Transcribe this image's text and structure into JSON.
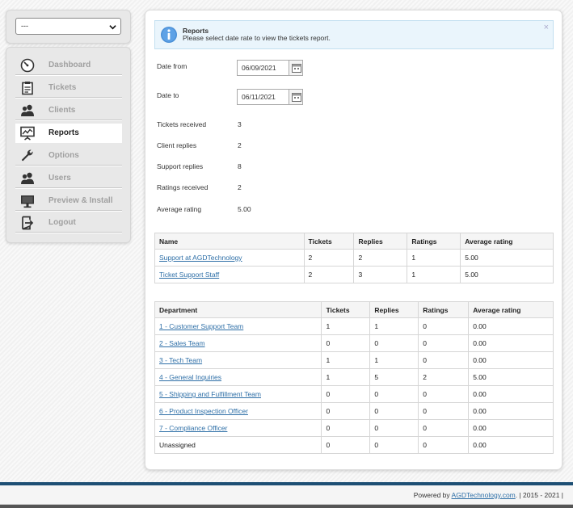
{
  "sidebar": {
    "select_value": "---",
    "items": [
      {
        "label": "Dashboard",
        "icon": "gauge-icon",
        "active": false
      },
      {
        "label": "Tickets",
        "icon": "clipboard-icon",
        "active": false
      },
      {
        "label": "Clients",
        "icon": "users-icon",
        "active": false
      },
      {
        "label": "Reports",
        "icon": "presentation-icon",
        "active": true
      },
      {
        "label": "Options",
        "icon": "wrench-icon",
        "active": false
      },
      {
        "label": "Users",
        "icon": "users-icon",
        "active": false
      },
      {
        "label": "Preview & Install",
        "icon": "monitor-icon",
        "active": false
      },
      {
        "label": "Logout",
        "icon": "logout-icon",
        "active": false
      }
    ]
  },
  "alert": {
    "title": "Reports",
    "message": "Please select date rate to view the tickets report.",
    "close": "×"
  },
  "form": {
    "date_from_label": "Date from",
    "date_from_value": "06/09/2021",
    "date_to_label": "Date to",
    "date_to_value": "06/11/2021"
  },
  "stats": [
    {
      "label": "Tickets received",
      "value": "3"
    },
    {
      "label": "Client replies",
      "value": "2"
    },
    {
      "label": "Support replies",
      "value": "8"
    },
    {
      "label": "Ratings received",
      "value": "2"
    },
    {
      "label": "Average rating",
      "value": "5.00"
    }
  ],
  "staff_table": {
    "headers": [
      "Name",
      "Tickets",
      "Replies",
      "Ratings",
      "Average rating"
    ],
    "rows": [
      [
        "Support at AGDTechnology",
        "2",
        "2",
        "1",
        "5.00"
      ],
      [
        "Ticket Support Staff",
        "2",
        "3",
        "1",
        "5.00"
      ]
    ]
  },
  "dept_table": {
    "headers": [
      "Department",
      "Tickets",
      "Replies",
      "Ratings",
      "Average rating"
    ],
    "rows": [
      [
        "1 - Customer Support Team",
        "1",
        "1",
        "0",
        "0.00",
        true
      ],
      [
        "2 - Sales Team",
        "0",
        "0",
        "0",
        "0.00",
        true
      ],
      [
        "3 - Tech Team",
        "1",
        "1",
        "0",
        "0.00",
        true
      ],
      [
        "4 - General Inquiries",
        "1",
        "5",
        "2",
        "5.00",
        true
      ],
      [
        "5 - Shipping and Fulfillment Team",
        "0",
        "0",
        "0",
        "0.00",
        true
      ],
      [
        "6 - Product Inspection Officer",
        "0",
        "0",
        "0",
        "0.00",
        true
      ],
      [
        "7 - Compliance Officer",
        "0",
        "0",
        "0",
        "0.00",
        true
      ],
      [
        "Unassigned",
        "0",
        "0",
        "0",
        "0.00",
        false
      ]
    ]
  },
  "footer": {
    "prefix": "Powered by ",
    "link": "AGDTechnology.com",
    "suffix": ". | 2015 - 2021 |"
  }
}
